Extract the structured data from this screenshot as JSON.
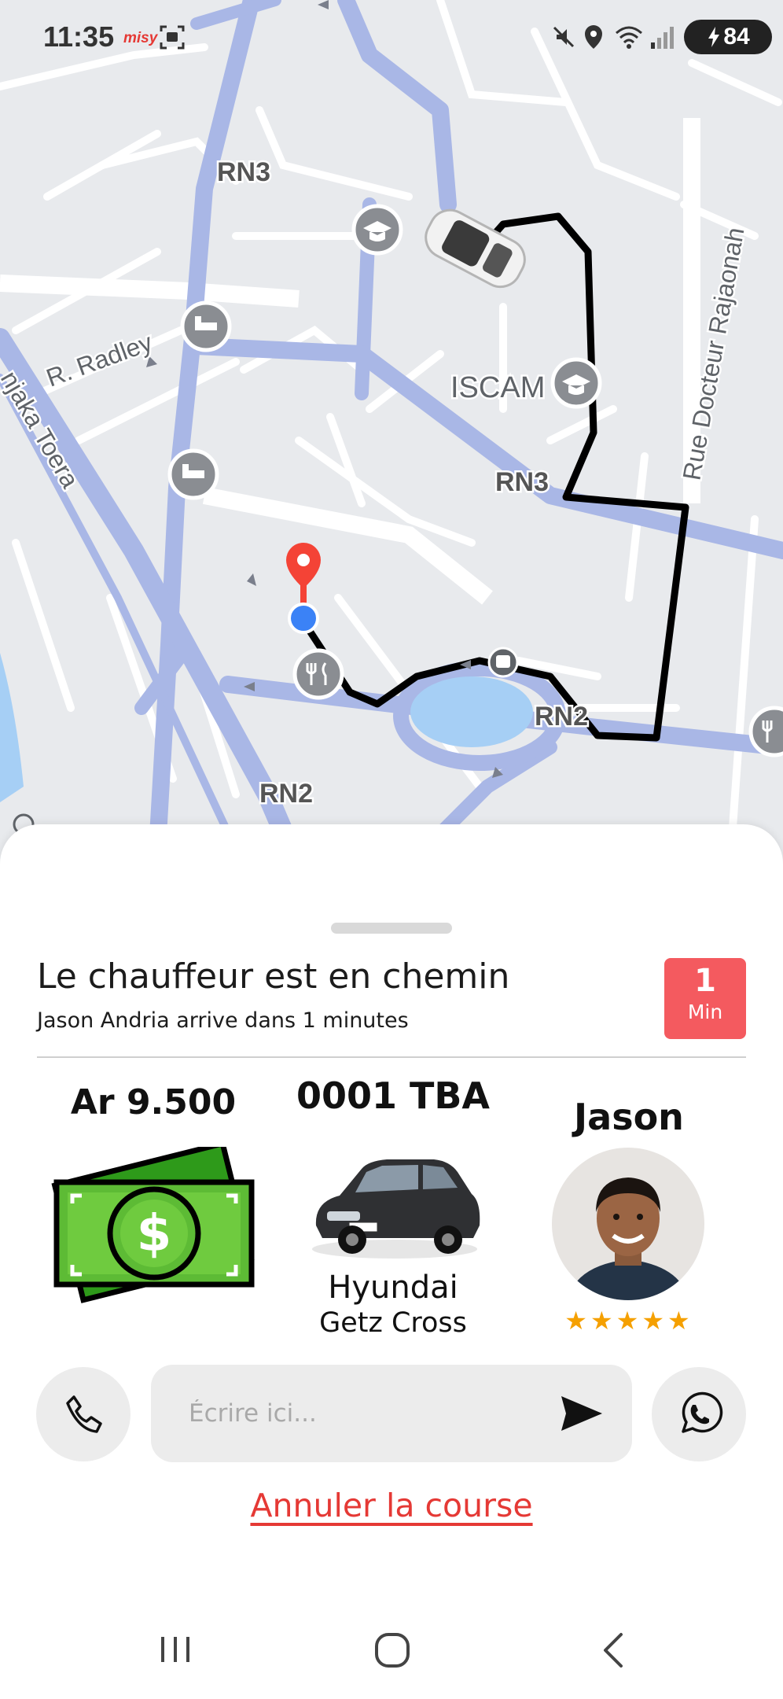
{
  "status_bar": {
    "time": "11:35",
    "brand": "misy",
    "battery": "84",
    "icons": [
      "screenshot-icon",
      "mute-icon",
      "location-icon",
      "wifi-icon",
      "signal-icon",
      "battery-icon"
    ]
  },
  "map": {
    "labels": {
      "rn3_top": "RN3",
      "rn3_mid": "RN3",
      "rn2_right": "RN2",
      "rn2_bottom": "RN2",
      "iscam": "ISCAM",
      "radley": "R. Radley",
      "rajaonah": "Rue Docteur Rajaonah",
      "toera": "njaka Toera"
    },
    "route_color": "#000000",
    "road_color": "#a9b7e6",
    "water_color": "#a6cff5",
    "pin_color": "#f44336",
    "user_dot_color": "#3b82f6",
    "poi_icons": [
      "school-icon",
      "school-icon",
      "hotel-icon",
      "hotel-icon",
      "restaurant-icon",
      "restaurant-icon",
      "bus-stop-icon"
    ]
  },
  "sheet": {
    "title": "Le chauffeur est en chemin",
    "subtitle": "Jason Andria arrive dans 1 minutes",
    "eta": {
      "value": "1",
      "unit": "Min"
    },
    "price": "Ar 9.500",
    "plate": "0001 TBA",
    "car_make": "Hyundai",
    "car_model": "Getz Cross",
    "driver_name": "Jason",
    "rating": 5,
    "stars": [
      "★",
      "★",
      "★",
      "★",
      "★"
    ],
    "message_placeholder": "Écrire ici...",
    "cancel_label": "Annuler la course",
    "accent_color": "#f45a5f",
    "link_color": "#e53935",
    "star_color": "#f5a000"
  },
  "nav_bar": {
    "icons": [
      "recent-apps-icon",
      "home-icon",
      "back-icon"
    ]
  }
}
